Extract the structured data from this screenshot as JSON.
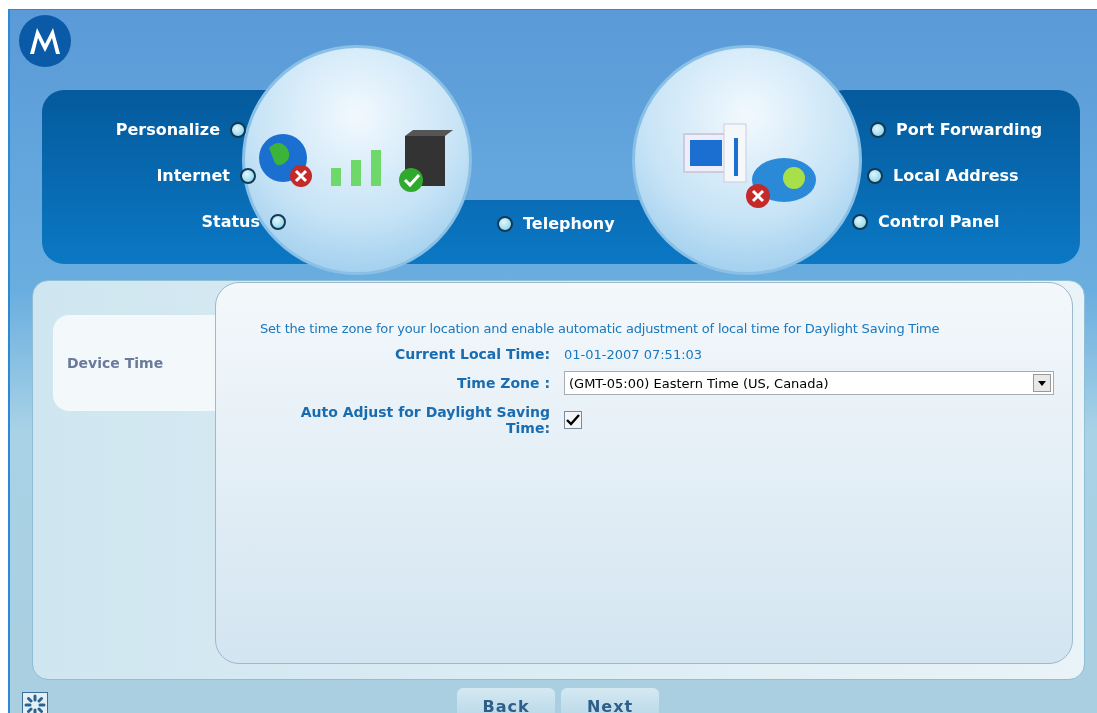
{
  "nav_left": [
    {
      "label": "Personalize"
    },
    {
      "label": "Internet"
    },
    {
      "label": "Status"
    }
  ],
  "nav_center": [
    {
      "label": "Telephony"
    }
  ],
  "nav_right": [
    {
      "label": "Port Forwarding"
    },
    {
      "label": "Local Address"
    },
    {
      "label": "Control Panel"
    }
  ],
  "sidebar": {
    "items": [
      {
        "label": "Device Time",
        "selected": true
      }
    ]
  },
  "form": {
    "intro": "Set the time zone for your location and enable automatic adjustment of local time for Daylight Saving Time",
    "current_time": {
      "label": "Current Local Time:",
      "value": "01-01-2007 07:51:03"
    },
    "time_zone": {
      "label": "Time Zone :",
      "value": "(GMT-05:00) Eastern Time (US, Canada)"
    },
    "auto_adjust": {
      "label": "Auto Adjust for Daylight Saving Time:",
      "checked": true
    }
  },
  "buttons": [
    "Back",
    "Next"
  ]
}
